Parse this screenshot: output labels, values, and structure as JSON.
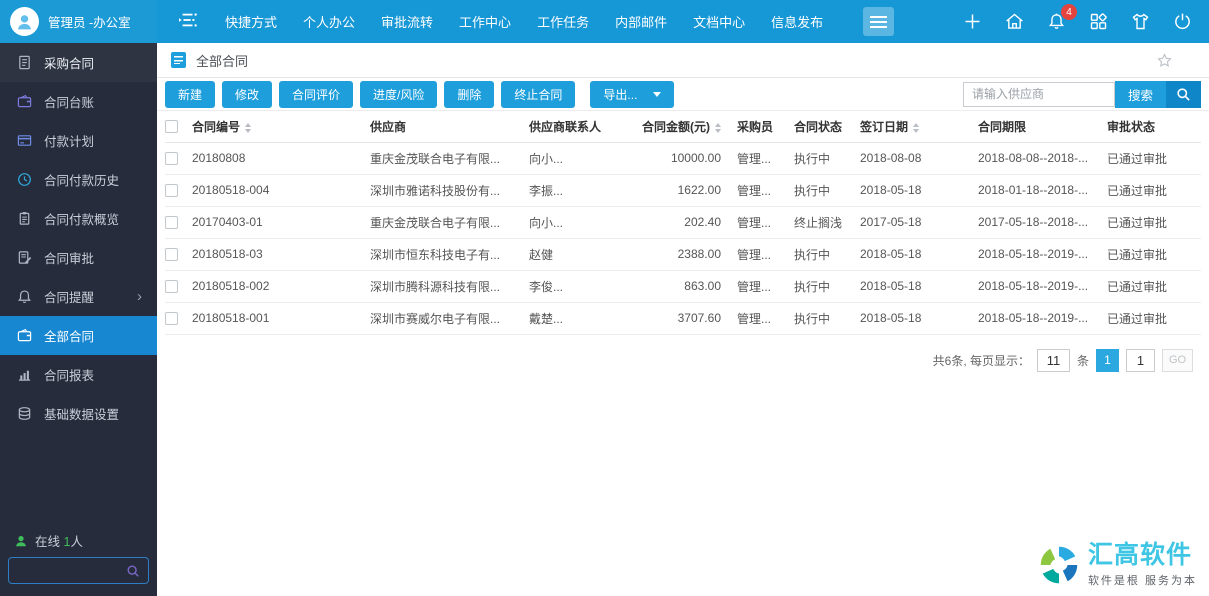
{
  "colors": {
    "topbar": "#1697d6",
    "accent": "#1e9fdc",
    "sidebar_bg": "#262c3b",
    "selected_item": "#1787d2",
    "badge": "#e5433d",
    "brand_cyan": "#3fc6e4",
    "online_green": "#3dbe5b"
  },
  "topbar": {
    "user_name": "管理员 -办公室",
    "nav_items": [
      {
        "label": "快捷方式"
      },
      {
        "label": "个人办公"
      },
      {
        "label": "审批流转"
      },
      {
        "label": "工作中心"
      },
      {
        "label": "工作任务"
      },
      {
        "label": "内部邮件"
      },
      {
        "label": "文档中心"
      },
      {
        "label": "信息发布"
      }
    ],
    "notification_badge": "4"
  },
  "sidebar": {
    "items": [
      {
        "label": "采购合同",
        "icon": "doc-icon",
        "icon_color": "#aeb6c4",
        "header": true
      },
      {
        "label": "合同台账",
        "icon": "wallet-icon",
        "icon_color": "#7d7be0"
      },
      {
        "label": "付款计划",
        "icon": "card-icon",
        "icon_color": "#6f8be8"
      },
      {
        "label": "合同付款历史",
        "icon": "clock-icon",
        "icon_color": "#2fa8dc"
      },
      {
        "label": "合同付款概览",
        "icon": "clipboard-icon",
        "icon_color": "#aeb6c4"
      },
      {
        "label": "合同审批",
        "icon": "docpen-icon",
        "icon_color": "#aeb6c4"
      },
      {
        "label": "合同提醒",
        "icon": "bell-icon",
        "icon_color": "#aeb6c4",
        "has_submenu": true
      },
      {
        "label": "全部合同",
        "icon": "wallet-icon",
        "icon_color": "#ffffff",
        "selected": true
      },
      {
        "label": "合同报表",
        "icon": "chart-icon",
        "icon_color": "#aeb6c4"
      },
      {
        "label": "基础数据设置",
        "icon": "database-icon",
        "icon_color": "#aeb6c4"
      }
    ],
    "online_label": "在线",
    "online_count": "1",
    "online_unit": "人"
  },
  "content": {
    "title": "全部合同",
    "toolbar": {
      "buttons": [
        {
          "label": "新建"
        },
        {
          "label": "修改"
        },
        {
          "label": "合同评价"
        },
        {
          "label": "进度/风险"
        },
        {
          "label": "删除"
        },
        {
          "label": "终止合同"
        }
      ],
      "export_label": "导出..."
    },
    "search": {
      "placeholder": "请输入供应商",
      "button_label": "搜索"
    },
    "table": {
      "columns": [
        {
          "label": "合同编号",
          "sortable": true
        },
        {
          "label": "供应商"
        },
        {
          "label": "供应商联系人"
        },
        {
          "label": "合同金额(元)",
          "sortable": true
        },
        {
          "label": "采购员"
        },
        {
          "label": "合同状态"
        },
        {
          "label": "签订日期",
          "sortable": true
        },
        {
          "label": "合同期限"
        },
        {
          "label": "审批状态"
        }
      ],
      "rows": [
        {
          "id": "20180808",
          "supplier": "重庆金茂联合电子有限...",
          "contact": "向小...",
          "amount": "10000.00",
          "buyer": "管理...",
          "status": "执行中",
          "sign_date": "2018-08-08",
          "period": "2018-08-08--2018-...",
          "approval": "已通过审批"
        },
        {
          "id": "20180518-004",
          "supplier": "深圳市雅诺科技股份有...",
          "contact": "李振...",
          "amount": "1622.00",
          "buyer": "管理...",
          "status": "执行中",
          "sign_date": "2018-05-18",
          "period": "2018-01-18--2018-...",
          "approval": "已通过审批"
        },
        {
          "id": "20170403-01",
          "supplier": "重庆金茂联合电子有限...",
          "contact": "向小...",
          "amount": "202.40",
          "buyer": "管理...",
          "status": "终止搁浅",
          "sign_date": "2017-05-18",
          "period": "2017-05-18--2018-...",
          "approval": "已通过审批"
        },
        {
          "id": "20180518-03",
          "supplier": "深圳市恒东科技电子有...",
          "contact": "赵健",
          "amount": "2388.00",
          "buyer": "管理...",
          "status": "执行中",
          "sign_date": "2018-05-18",
          "period": "2018-05-18--2019-...",
          "approval": "已通过审批"
        },
        {
          "id": "20180518-002",
          "supplier": "深圳市腾科源科技有限...",
          "contact": "李俊...",
          "amount": "863.00",
          "buyer": "管理...",
          "status": "执行中",
          "sign_date": "2018-05-18",
          "period": "2018-05-18--2019-...",
          "approval": "已通过审批"
        },
        {
          "id": "20180518-001",
          "supplier": "深圳市赛威尔电子有限...",
          "contact": "戴楚...",
          "amount": "3707.60",
          "buyer": "管理...",
          "status": "执行中",
          "sign_date": "2018-05-18",
          "period": "2018-05-18--2019-...",
          "approval": "已通过审批"
        }
      ]
    },
    "pagination": {
      "total_text": "共6条, 每页显示：",
      "page_size": "11",
      "unit": "条",
      "current_page": "1",
      "goto_value": "1",
      "go_label": "GO"
    }
  },
  "brand": {
    "name": "汇高软件",
    "tagline": "软件是根  服务为本"
  }
}
